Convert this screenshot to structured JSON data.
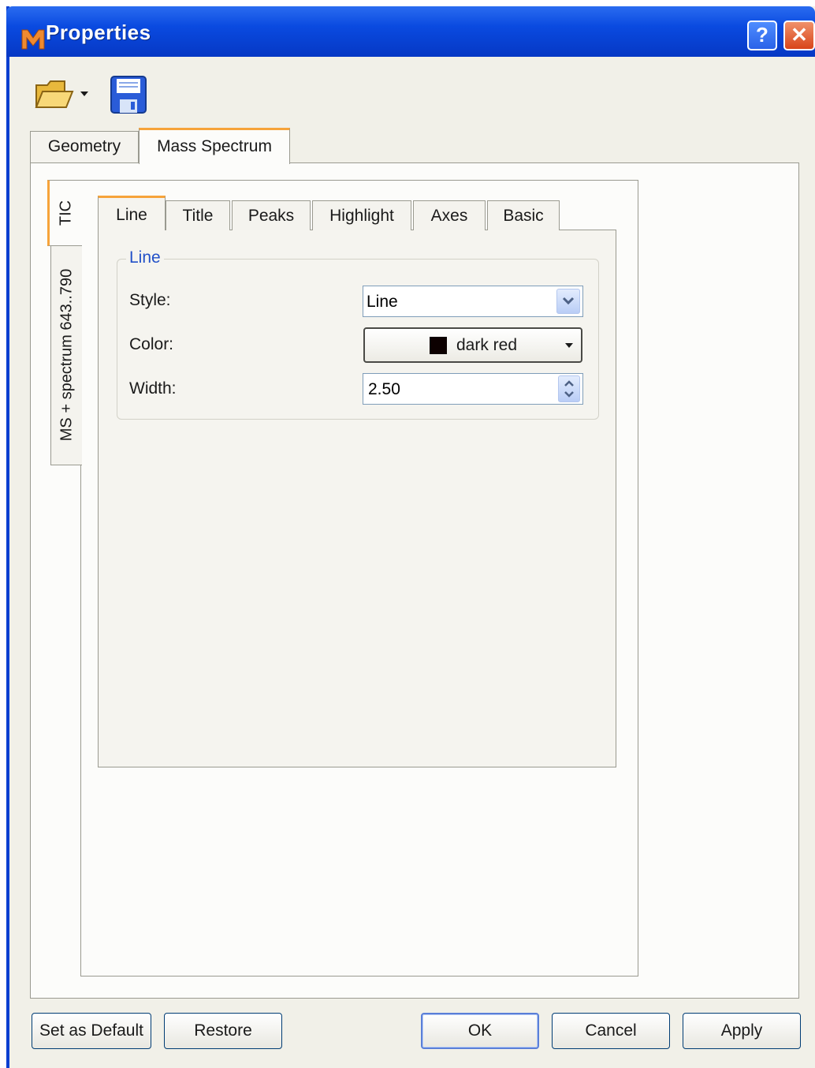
{
  "window": {
    "title": "Properties",
    "help_label": "?",
    "close_label": "✕"
  },
  "toolbar": {
    "open_icon": "folder-open-icon",
    "save_icon": "floppy-save-icon"
  },
  "outer_tabs": [
    {
      "label": "Geometry",
      "active": false
    },
    {
      "label": "Mass Spectrum",
      "active": true
    }
  ],
  "side_tabs": [
    {
      "label": "TIC",
      "active": true
    },
    {
      "label": "MS + spectrum 643..790",
      "active": false
    }
  ],
  "inner_tabs": [
    {
      "label": "Line",
      "active": true
    },
    {
      "label": "Title",
      "active": false
    },
    {
      "label": "Peaks",
      "active": false
    },
    {
      "label": "Highlight",
      "active": false
    },
    {
      "label": "Axes",
      "active": false
    },
    {
      "label": "Basic",
      "active": false
    }
  ],
  "line_group": {
    "title": "Line",
    "style_label": "Style:",
    "style_value": "Line",
    "color_label": "Color:",
    "color_value": "dark red",
    "color_swatch": "#0c0000",
    "width_label": "Width:",
    "width_value": "2.50"
  },
  "buttons": {
    "set_default": "Set as Default",
    "restore": "Restore",
    "ok": "OK",
    "cancel": "Cancel",
    "apply": "Apply"
  },
  "colors": {
    "titlebar": "#0a4ae0",
    "tab_highlight": "#f6a33a",
    "group_title": "#2250c8"
  }
}
